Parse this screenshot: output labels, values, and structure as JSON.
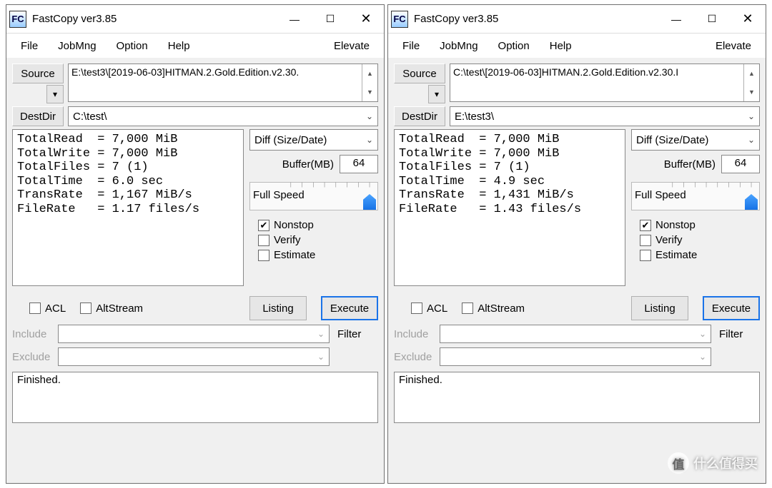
{
  "windows": [
    {
      "title": "FastCopy ver3.85",
      "menu": {
        "file": "File",
        "jobmng": "JobMng",
        "option": "Option",
        "help": "Help",
        "elevate": "Elevate"
      },
      "source_label": "Source",
      "source_path": "E:\\test3\\[2019-06-03]HITMAN.2.Gold.Edition.v2.30.",
      "dest_label": "DestDir",
      "dest_path": "C:\\test\\",
      "stats_text": "TotalRead  = 7,000 MiB\nTotalWrite = 7,000 MiB\nTotalFiles = 7 (1)\nTotalTime  = 6.0 sec\nTransRate  = 1,167 MiB/s\nFileRate   = 1.17 files/s",
      "mode": "Diff (Size/Date)",
      "buffer_label": "Buffer(MB)",
      "buffer_value": "64",
      "speed_label": "Full Speed",
      "nonstop": true,
      "nonstop_label": "Nonstop",
      "verify": false,
      "verify_label": "Verify",
      "estimate": false,
      "estimate_label": "Estimate",
      "acl_label": "ACL",
      "altstream_label": "AltStream",
      "listing_label": "Listing",
      "execute_label": "Execute",
      "include_label": "Include",
      "exclude_label": "Exclude",
      "filter_label": "Filter",
      "log_text": "Finished."
    },
    {
      "title": "FastCopy ver3.85",
      "menu": {
        "file": "File",
        "jobmng": "JobMng",
        "option": "Option",
        "help": "Help",
        "elevate": "Elevate"
      },
      "source_label": "Source",
      "source_path": "C:\\test\\[2019-06-03]HITMAN.2.Gold.Edition.v2.30.I",
      "dest_label": "DestDir",
      "dest_path": "E:\\test3\\",
      "stats_text": "TotalRead  = 7,000 MiB\nTotalWrite = 7,000 MiB\nTotalFiles = 7 (1)\nTotalTime  = 4.9 sec\nTransRate  = 1,431 MiB/s\nFileRate   = 1.43 files/s",
      "mode": "Diff (Size/Date)",
      "buffer_label": "Buffer(MB)",
      "buffer_value": "64",
      "speed_label": "Full Speed",
      "nonstop": true,
      "nonstop_label": "Nonstop",
      "verify": false,
      "verify_label": "Verify",
      "estimate": false,
      "estimate_label": "Estimate",
      "acl_label": "ACL",
      "altstream_label": "AltStream",
      "listing_label": "Listing",
      "execute_label": "Execute",
      "include_label": "Include",
      "exclude_label": "Exclude",
      "filter_label": "Filter",
      "log_text": "Finished."
    }
  ],
  "watermark": "什么值得买"
}
